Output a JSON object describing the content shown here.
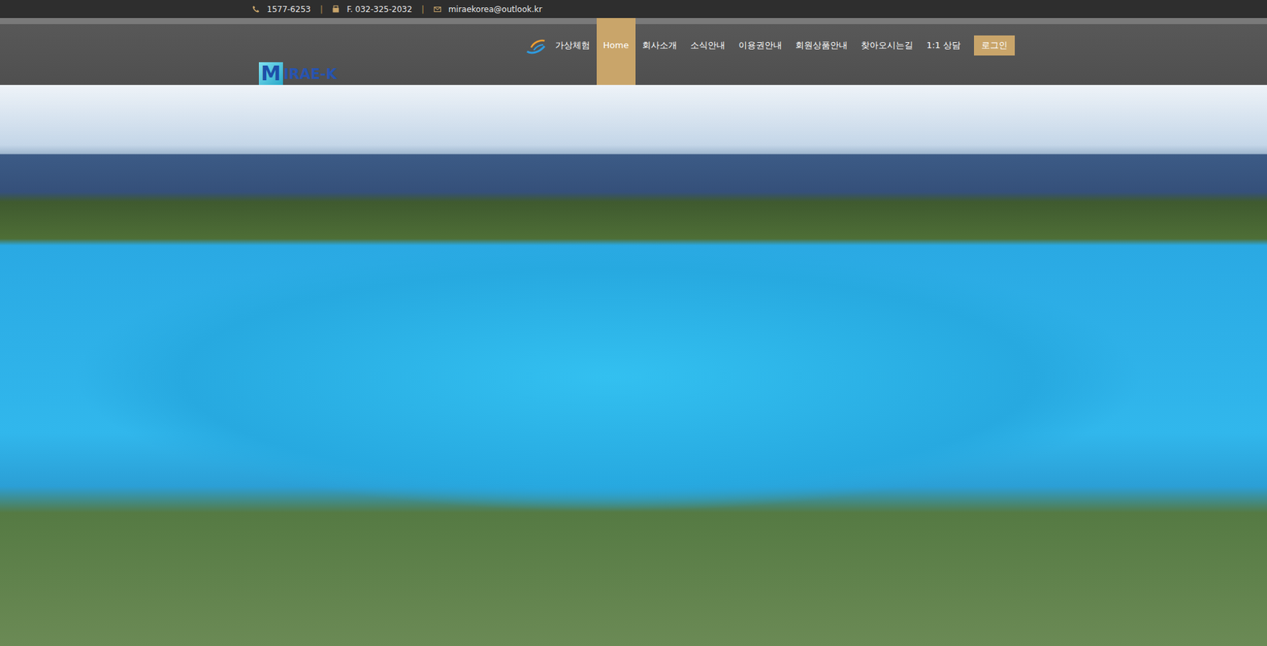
{
  "topbar": {
    "separator": "|",
    "contacts": [
      {
        "kind": "phone",
        "text": "1577-6253"
      },
      {
        "kind": "fax",
        "text": "F. 032-325-2032"
      },
      {
        "kind": "mail",
        "text": "miraekorea@outlook.kr"
      }
    ]
  },
  "logo": {
    "letter": "M",
    "text": "IRAE-K"
  },
  "nav": {
    "items": [
      {
        "label": "가상체험",
        "selected": false,
        "kind": "icon"
      },
      {
        "label": "Home",
        "selected": true,
        "kind": "plain"
      },
      {
        "label": "회사소개",
        "selected": false,
        "kind": "plain"
      },
      {
        "label": "소식안내",
        "selected": false,
        "kind": "plain"
      },
      {
        "label": "이용권안내",
        "selected": false,
        "kind": "plain"
      },
      {
        "label": "회원상품안내",
        "selected": false,
        "kind": "plain"
      },
      {
        "label": "찾아오시는길",
        "selected": false,
        "kind": "plain"
      },
      {
        "label": "1:1 상담",
        "selected": false,
        "kind": "plain"
      }
    ],
    "login": "로그인"
  }
}
